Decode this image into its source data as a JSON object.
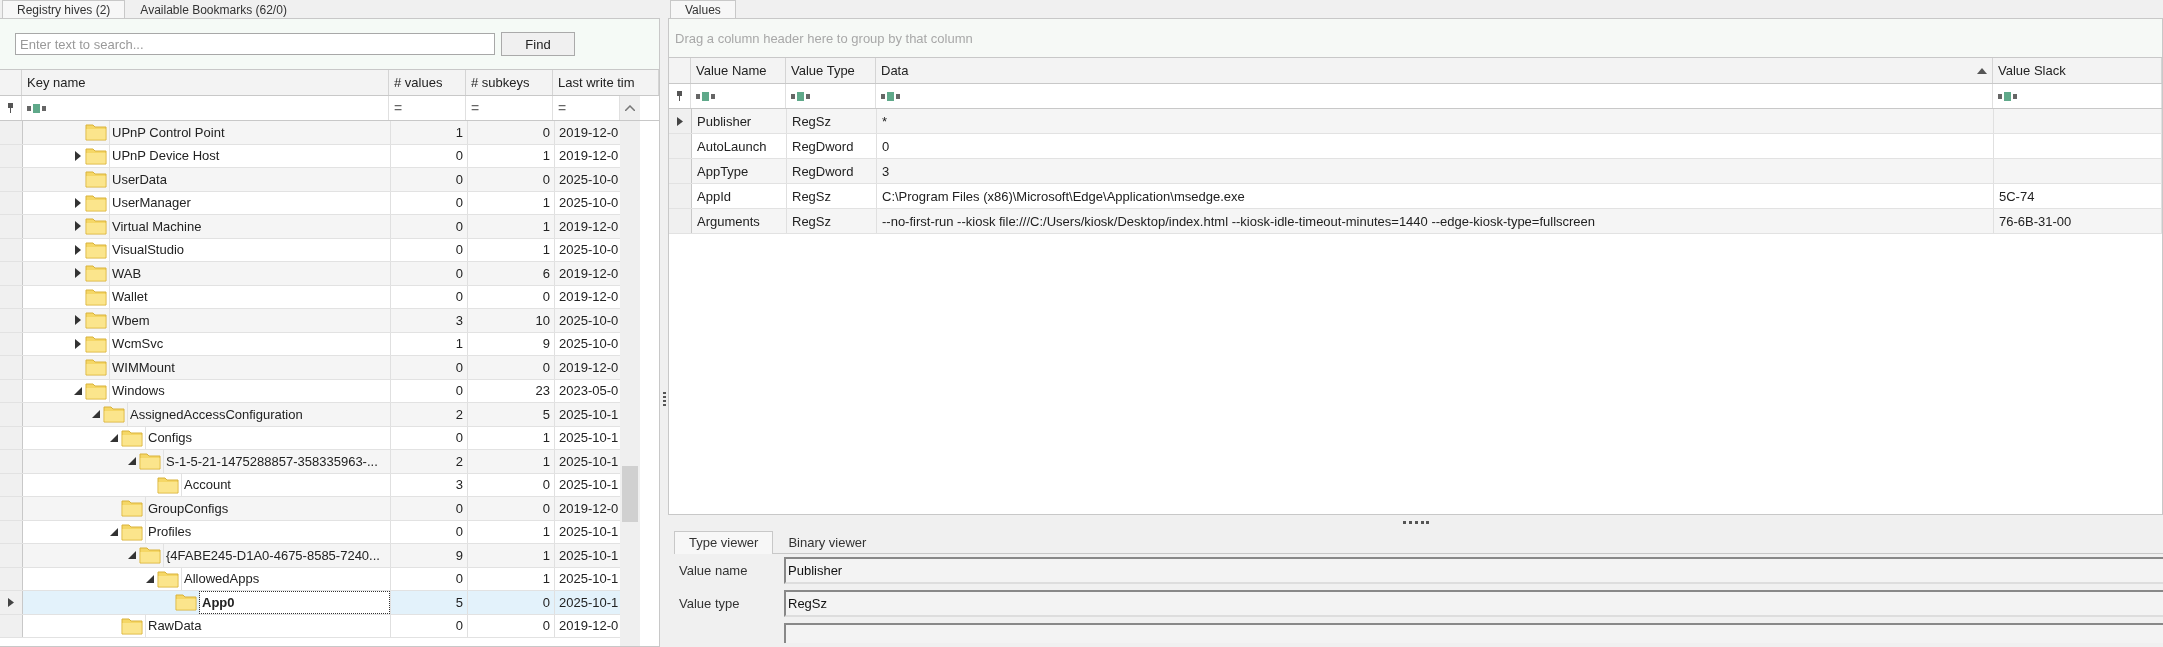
{
  "left_tabs": [
    {
      "label": "Registry hives (2)",
      "selected": true
    },
    {
      "label": "Available Bookmarks (62/0)",
      "selected": false
    }
  ],
  "search": {
    "placeholder": "Enter text to search...",
    "button": "Find"
  },
  "tree": {
    "columns": [
      "Key name",
      "# values",
      "# subkeys",
      "Last write tim"
    ],
    "filters": [
      "=",
      "=",
      "="
    ],
    "rows": [
      {
        "name": "UPnP Control Point",
        "values": "1",
        "subkeys": "0",
        "time": "2019-12-0",
        "selected": false
      },
      {
        "name": "UPnP Device Host",
        "values": "0",
        "subkeys": "1",
        "time": "2019-12-0",
        "expanded": false,
        "selected": false
      },
      {
        "name": "UserData",
        "values": "0",
        "subkeys": "0",
        "time": "2025-10-0",
        "selected": false
      },
      {
        "name": "UserManager",
        "values": "0",
        "subkeys": "1",
        "time": "2025-10-0",
        "expanded": false,
        "selected": false
      },
      {
        "name": "Virtual Machine",
        "values": "0",
        "subkeys": "1",
        "time": "2019-12-0",
        "expanded": false,
        "selected": false
      },
      {
        "name": "VisualStudio",
        "values": "0",
        "subkeys": "1",
        "time": "2025-10-0",
        "expanded": false,
        "selected": false
      },
      {
        "name": "WAB",
        "values": "0",
        "subkeys": "6",
        "time": "2019-12-0",
        "expanded": false,
        "selected": false
      },
      {
        "name": "Wallet",
        "values": "0",
        "subkeys": "0",
        "time": "2019-12-0",
        "selected": false
      },
      {
        "name": "Wbem",
        "values": "3",
        "subkeys": "10",
        "time": "2025-10-0",
        "expanded": false,
        "selected": false
      },
      {
        "name": "WcmSvc",
        "values": "1",
        "subkeys": "9",
        "time": "2025-10-0",
        "expanded": false,
        "selected": false
      },
      {
        "name": "WIMMount",
        "values": "0",
        "subkeys": "0",
        "time": "2019-12-0",
        "selected": false
      },
      {
        "name": "Windows",
        "values": "0",
        "subkeys": "23",
        "time": "2023-05-0",
        "expanded": true,
        "selected": false,
        "children": [
          {
            "name": "AssignedAccessConfiguration",
            "values": "2",
            "subkeys": "5",
            "time": "2025-10-1",
            "expanded": true,
            "selected": false,
            "children": [
              {
                "name": "Configs",
                "values": "0",
                "subkeys": "1",
                "time": "2025-10-1",
                "expanded": true,
                "selected": false,
                "children": [
                  {
                    "name": "S-1-5-21-1475288857-358335963-...",
                    "values": "2",
                    "subkeys": "1",
                    "time": "2025-10-1",
                    "expanded": true,
                    "selected": false,
                    "children": [
                      {
                        "name": "Account",
                        "values": "3",
                        "subkeys": "0",
                        "time": "2025-10-1",
                        "selected": false
                      }
                    ]
                  }
                ]
              },
              {
                "name": "GroupConfigs",
                "values": "0",
                "subkeys": "0",
                "time": "2019-12-0",
                "selected": false
              },
              {
                "name": "Profiles",
                "values": "0",
                "subkeys": "1",
                "time": "2025-10-1",
                "expanded": true,
                "selected": false,
                "children": [
                  {
                    "name": "{4FABE245-D1A0-4675-8585-7240...",
                    "values": "9",
                    "subkeys": "1",
                    "time": "2025-10-1",
                    "expanded": true,
                    "selected": false,
                    "children": [
                      {
                        "name": "AllowedApps",
                        "values": "0",
                        "subkeys": "1",
                        "time": "2025-10-1",
                        "expanded": true,
                        "selected": false,
                        "children": [
                          {
                            "name": "App0",
                            "values": "5",
                            "subkeys": "0",
                            "time": "2025-10-1",
                            "selected": true
                          }
                        ]
                      }
                    ]
                  }
                ]
              },
              {
                "name": "RawData",
                "values": "0",
                "subkeys": "0",
                "time": "2019-12-0",
                "selected": false
              }
            ]
          }
        ]
      }
    ]
  },
  "right_tabs": [
    {
      "label": "Values",
      "selected": true
    }
  ],
  "group_panel": "Drag a column header here to group by that column",
  "values": {
    "columns": [
      {
        "label": "Value Name",
        "sorted": false
      },
      {
        "label": "Value Type",
        "sorted": false
      },
      {
        "label": "Data",
        "sorted": true
      },
      {
        "label": "Value Slack",
        "sorted": false
      }
    ],
    "rows": [
      {
        "name": "Publisher",
        "type": "RegSz",
        "data": "*",
        "selected": true
      },
      {
        "name": "AutoLaunch",
        "type": "RegDword",
        "data": "0",
        "selected": false
      },
      {
        "name": "AppType",
        "type": "RegDword",
        "data": "3",
        "selected": false
      },
      {
        "name": "AppId",
        "type": "RegSz",
        "data": "C:\\Program Files (x86)\\Microsoft\\Edge\\Application\\msedge.exe",
        "slack": "5C-74",
        "selected": false
      },
      {
        "name": "Arguments",
        "type": "RegSz",
        "data": "--no-first-run --kiosk file:///C:/Users/kiosk/Desktop/index.html --kiosk-idle-timeout-minutes=1440 --edge-kiosk-type=fullscreen",
        "slack": "76-6B-31-00",
        "selected": false
      }
    ]
  },
  "viewer": {
    "tabs": [
      {
        "label": "Type viewer",
        "selected": true
      },
      {
        "label": "Binary viewer",
        "selected": false
      }
    ],
    "fields": [
      {
        "label": "Value name",
        "value": "Publisher"
      },
      {
        "label": "Value type",
        "value": "RegSz"
      }
    ]
  }
}
